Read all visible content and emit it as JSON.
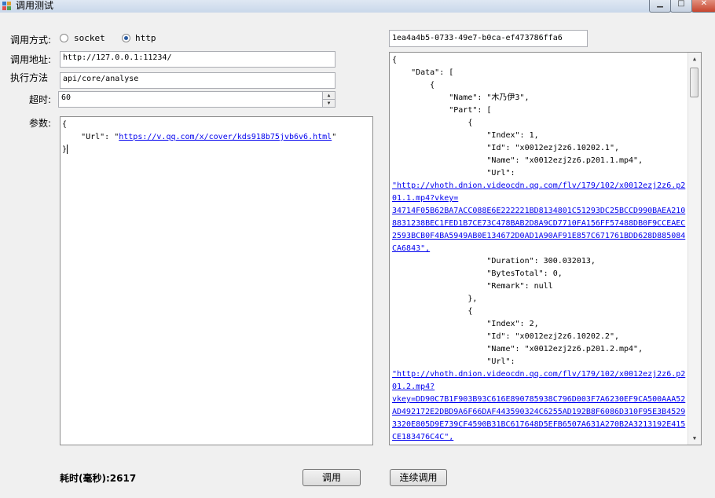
{
  "window": {
    "title": "调用测试"
  },
  "form": {
    "mode_label": "调用方式:",
    "mode_options": [
      {
        "label": "socket",
        "checked": false
      },
      {
        "label": "http",
        "checked": true
      }
    ],
    "address_label": "调用地址:",
    "address_value": "http://127.0.0.1:11234/",
    "method_label": "执行方法",
    "method_value": "api/core/analyse",
    "timeout_label": "超时:",
    "timeout_value": "60",
    "params_label": "参数:",
    "params_lines": [
      "{",
      "    \"Url\": \"",
      "https://v.qq.com/x/cover/kds918b75jvb6v6.html",
      "\"",
      "}"
    ]
  },
  "result": {
    "guid": "1ea4a4b5-0733-49e7-b0ca-ef473786ffa6",
    "lines": [
      "{",
      "    \"Data\": [",
      "        {",
      "            \"Name\": \"木乃伊3\",",
      "            \"Part\": [",
      "                {",
      "                    \"Index\": 1,",
      "                    \"Id\": \"x0012ezj2z6.10202.1\",",
      "                    \"Name\": \"x0012ezj2z6.p201.1.mp4\",",
      "                    \"Url\":",
      "\"http://vhoth.dnion.videocdn.qq.com/flv/179/102/x0012ezj2z6.p2",
      "01.1.mp4?vkey=",
      "34714F05B62BA7ACC088E6E222221BD8134801C51293DC25BCCD990BAEA210",
      "8831238BEC1FED1B7CE73C478BAB2D8A9CD7710FA156FF57488DB0F9CCEAEC",
      "2593BCB0F4BA5949AB0E134672D0AD1A90AF91E857C671761BDD628D885084",
      "CA6843\",",
      "                    \"Duration\": 300.032013,",
      "                    \"BytesTotal\": 0,",
      "                    \"Remark\": null",
      "                },",
      "                {",
      "                    \"Index\": 2,",
      "                    \"Id\": \"x0012ezj2z6.10202.2\",",
      "                    \"Name\": \"x0012ezj2z6.p201.2.mp4\",",
      "                    \"Url\":",
      "\"http://vhoth.dnion.videocdn.qq.com/flv/179/102/x0012ezj2z6.p2",
      "01.2.mp4?",
      "vkey=DD90C7B1F903B93C616E890785938C796D003F7A6230EF9CA500AAA52",
      "AD492172E2DBD9A6F66DAF443590324C6255AD192B8F6086D310F95E3B4529",
      "3320E805D9E739CF4590B31BC617648D5EFB6507A631A270B2A3213192E415",
      "CE183476C4C\","
    ]
  },
  "footer": {
    "elapsed_label": "耗时(毫秒):2617",
    "call_button": "调用",
    "continuous_button": "连续调用"
  }
}
